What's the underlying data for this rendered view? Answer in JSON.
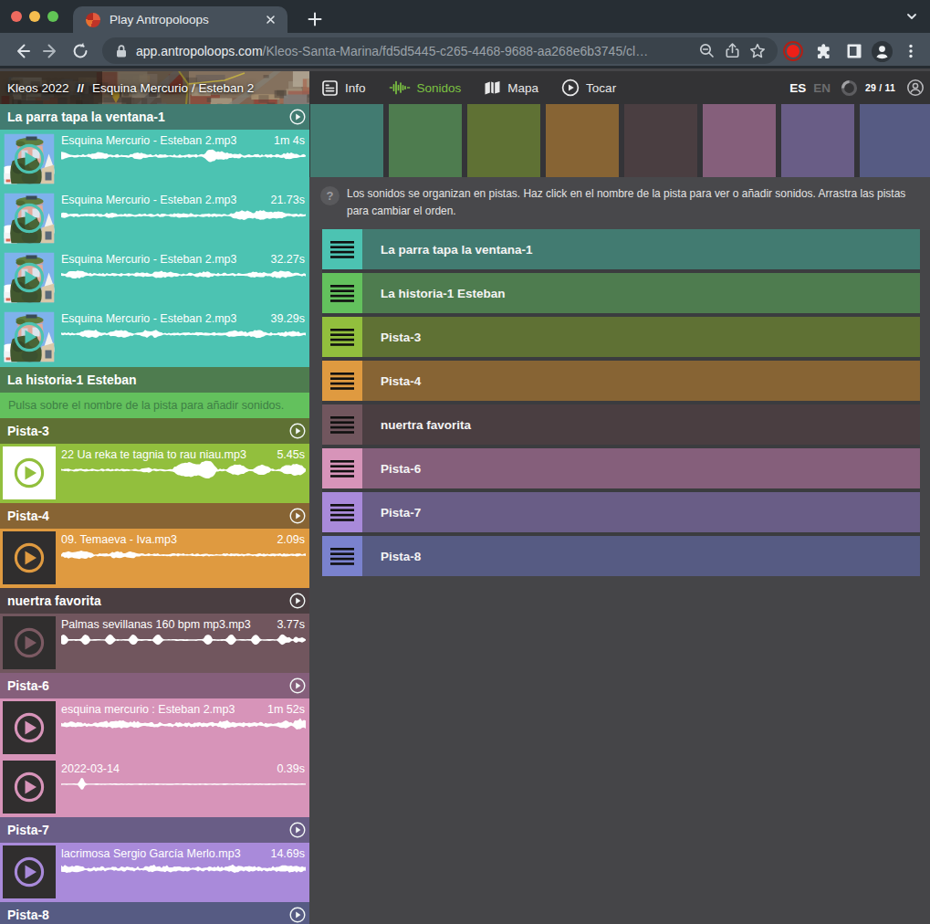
{
  "browser": {
    "tab_title": "Play Antropoloops",
    "url_host": "app.antropoloops.com",
    "url_path": "/Kleos-Santa-Marina/fd5d5445-c265-4468-9688-aa268e6b3745/cl…"
  },
  "app_header": {
    "project": "Kleos 2022",
    "separator": "//",
    "remix": "Esquina Mercurio / Esteban 2",
    "nav": [
      {
        "id": "info",
        "label": "Info",
        "active": false
      },
      {
        "id": "sonidos",
        "label": "Sonidos",
        "active": true
      },
      {
        "id": "mapa",
        "label": "Mapa",
        "active": false
      },
      {
        "id": "tocar",
        "label": "Tocar",
        "active": false
      }
    ],
    "languages": [
      {
        "code": "ES",
        "active": true
      },
      {
        "code": "EN",
        "active": false
      }
    ],
    "counter": "29 / 11",
    "accent_green": "#7cc242"
  },
  "main": {
    "help_icon": "?",
    "help_text": "Los sonidos se organizan en pistas. Haz click en el nombre de la pista para ver o añadir sonidos. Arrastra las pistas para cambiar el orden."
  },
  "tracks": [
    {
      "name": "La parra tapa la ventana-1",
      "color_dark": "#427B71",
      "color_bright": "#4CC3B2",
      "has_play": true,
      "empty_hint": null,
      "clips": [
        {
          "title": "Esquina Mercurio - Esteban 2.mp3",
          "duration": "1m 4s",
          "thumb": "photo",
          "wave": "band",
          "seed": 11
        },
        {
          "title": "Esquina Mercurio - Esteban 2.mp3",
          "duration": "21.73s",
          "thumb": "photo",
          "wave": "band",
          "seed": 23
        },
        {
          "title": "Esquina Mercurio - Esteban 2.mp3",
          "duration": "32.27s",
          "thumb": "photo",
          "wave": "band",
          "seed": 37
        },
        {
          "title": "Esquina Mercurio - Esteban 2.mp3",
          "duration": "39.29s",
          "thumb": "photo",
          "wave": "band",
          "seed": 45
        }
      ]
    },
    {
      "name": "La historia-1 Esteban",
      "color_dark": "#4E7C4F",
      "color_bright": "#63C15D",
      "has_play": false,
      "empty_hint": "Pulsa sobre el nombre de la pista para añadir sonidos.",
      "hint_color": "#3E7F45",
      "clips": []
    },
    {
      "name": "Pista-3",
      "color_dark": "#5F7134",
      "color_bright": "#92BF3D",
      "has_play": true,
      "empty_hint": null,
      "clips": [
        {
          "title": "22 Ua reka te tagnia to rau niau.mp3",
          "duration": "5.45s",
          "thumb": "white",
          "wave": "blob",
          "seed": 52
        }
      ]
    },
    {
      "name": "Pista-4",
      "color_dark": "#876434",
      "color_bright": "#DF9A40",
      "has_play": true,
      "empty_hint": null,
      "clips": [
        {
          "title": "09. Temaeva - Iva.mp3",
          "duration": "2.09s",
          "thumb": "dark",
          "wave": "thin",
          "seed": 63
        }
      ]
    },
    {
      "name": "nuertra favorita",
      "color_dark": "#4A3E41",
      "color_bright": "#71565E",
      "has_play": true,
      "empty_hint": null,
      "clips": [
        {
          "title": "Palmas sevillanas 160 bpm mp3.mp3",
          "duration": "3.77s",
          "thumb": "dark",
          "wave": "spikes",
          "seed": 71
        }
      ]
    },
    {
      "name": "Pista-6",
      "color_dark": "#855F7B",
      "color_bright": "#D794B9",
      "has_play": true,
      "empty_hint": null,
      "clips": [
        {
          "title": "esquina mercurio : Esteban 2.mp3",
          "duration": "1m 52s",
          "thumb": "dark",
          "wave": "rough",
          "seed": 82
        },
        {
          "title": "2022-03-14",
          "duration": "0.39s",
          "thumb": "dark",
          "wave": "flatspike",
          "seed": 90
        }
      ]
    },
    {
      "name": "Pista-7",
      "color_dark": "#695D86",
      "color_bright": "#A98ADA",
      "has_play": true,
      "empty_hint": null,
      "clips": [
        {
          "title": "lacrimosa Sergio García Merlo.mp3",
          "duration": "14.69s",
          "thumb": "dark",
          "wave": "rough",
          "seed": 97
        }
      ]
    },
    {
      "name": "Pista-8",
      "color_dark": "#565B83",
      "color_bright": "#7A82CE",
      "has_play": true,
      "empty_hint": null,
      "clips": []
    }
  ]
}
